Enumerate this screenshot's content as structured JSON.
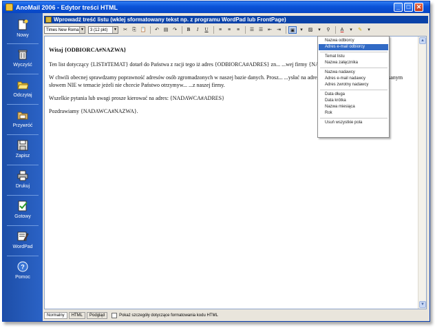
{
  "window": {
    "title": "AnoMail 2006 - Edytor treści HTML"
  },
  "sidebar": {
    "items": [
      {
        "label": "Nowy",
        "icon": "new-document-icon"
      },
      {
        "label": "Wyczyść",
        "icon": "trash-icon"
      },
      {
        "label": "Odczytaj",
        "icon": "open-folder-icon"
      },
      {
        "label": "Przywróć",
        "icon": "restore-folder-icon"
      },
      {
        "label": "Zapisz",
        "icon": "save-disk-icon"
      },
      {
        "label": "Drukuj",
        "icon": "printer-icon"
      },
      {
        "label": "Gotowy",
        "icon": "check-document-icon"
      },
      {
        "label": "WordPad",
        "icon": "wordpad-icon"
      },
      {
        "label": "Pomoc",
        "icon": "help-icon"
      }
    ]
  },
  "header": {
    "text": "Wprowadź treść listu (wklej sformatowany tekst np. z programu WordPad lub FrontPage)"
  },
  "toolbar": {
    "font": "Times New Roma",
    "size": "3 (12 pkt)",
    "bold": "B",
    "italic": "I",
    "underline": "U"
  },
  "editor": {
    "greeting": "Witaj {ODBIORCA#NAZWA}",
    "p1": "Ten list dotyczący {LIST#TEMAT} dotarł do Państwa z racji tego iż adres {ODBIORCA#ADRES} zn... ...wej firmy {NADAWCA#NAZWA}.",
    "p2": "W chwili obecnej sprawdzamy poprawność adresów osób zgromadzonych w naszej bazie danych. Prosz... ...ysłać na adres {NADAWCA#ADRES} z wpisanym słowem NIE w temacie jeżeli nie chcecie Państwo otrzymyw... ...z naszej firmy.",
    "p3": "Wszelkie pytania lub uwagi prosze kierować na adres: {NADAWCA#ADRES}",
    "p4": "Pozdrawiamy {NADAWCA#NAZWA}."
  },
  "bottom": {
    "tabs": [
      "Normalny",
      "HTML",
      "Podgląd"
    ],
    "checkbox_label": "Pokaż szczegóły dotyczące formatowania kodu HTML"
  },
  "menu": {
    "groups": [
      [
        "Nazwa odbiorcy",
        "Adres e-mail odbiorcy"
      ],
      [
        "Temat listu",
        "Nazwa załącznika"
      ],
      [
        "Nazwa nadawcy",
        "Adres e-mail nadawcy",
        "Adres zwrotny nadawcy"
      ],
      [
        "Data długa",
        "Data krótka",
        "Nazwa miesiąca",
        "Rok"
      ],
      [
        "Usuń wszystkie pola"
      ]
    ],
    "selected": "Adres e-mail odbiorcy"
  },
  "colors": {
    "accent": "#316ac5",
    "sidebar": "#2b63c6",
    "header": "#0a42a8"
  }
}
